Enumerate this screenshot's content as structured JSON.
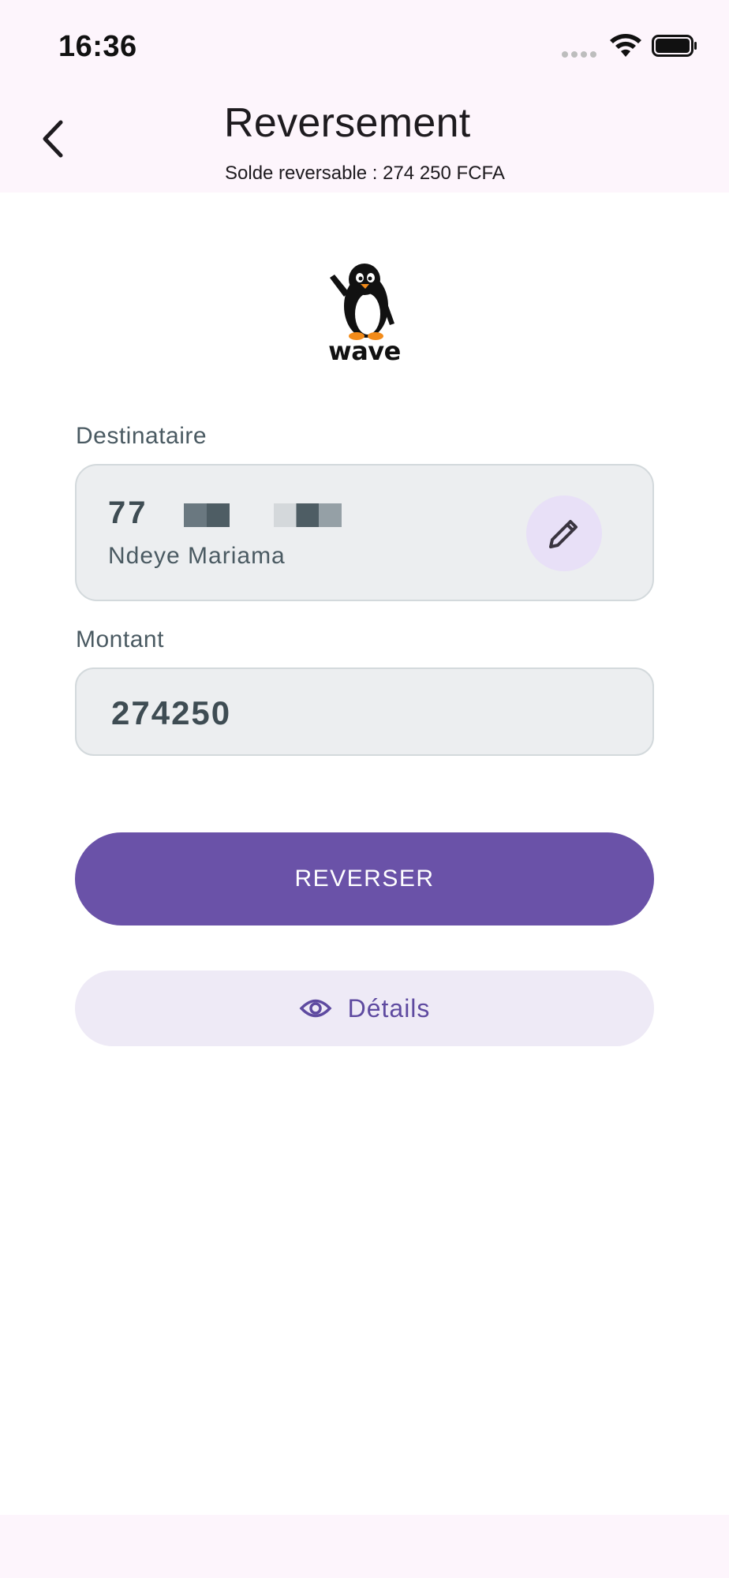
{
  "status_bar": {
    "time": "16:36",
    "icons": [
      "signal-icon",
      "wifi-icon",
      "battery-icon"
    ]
  },
  "header": {
    "back_icon": "chevron-left-icon",
    "title": "Reversement",
    "subtitle": "Solde reversable : 274 250 FCFA"
  },
  "logo": {
    "icon": "penguin-icon",
    "text": "wave"
  },
  "recipient": {
    "label": "Destinataire",
    "phone_prefix": "77",
    "name": "Ndeye Mariama",
    "edit_icon": "pencil-icon"
  },
  "amount": {
    "label": "Montant",
    "value": "274250"
  },
  "actions": {
    "primary_label": "REVERSER",
    "secondary_label": "Détails",
    "secondary_icon": "eye-icon"
  },
  "colors": {
    "header_bg": "#fdf5fc",
    "primary": "#6a52a8",
    "secondary_bg": "#eeeaf6",
    "field_bg": "#eceef0",
    "edit_bg": "#e8e0f7"
  }
}
